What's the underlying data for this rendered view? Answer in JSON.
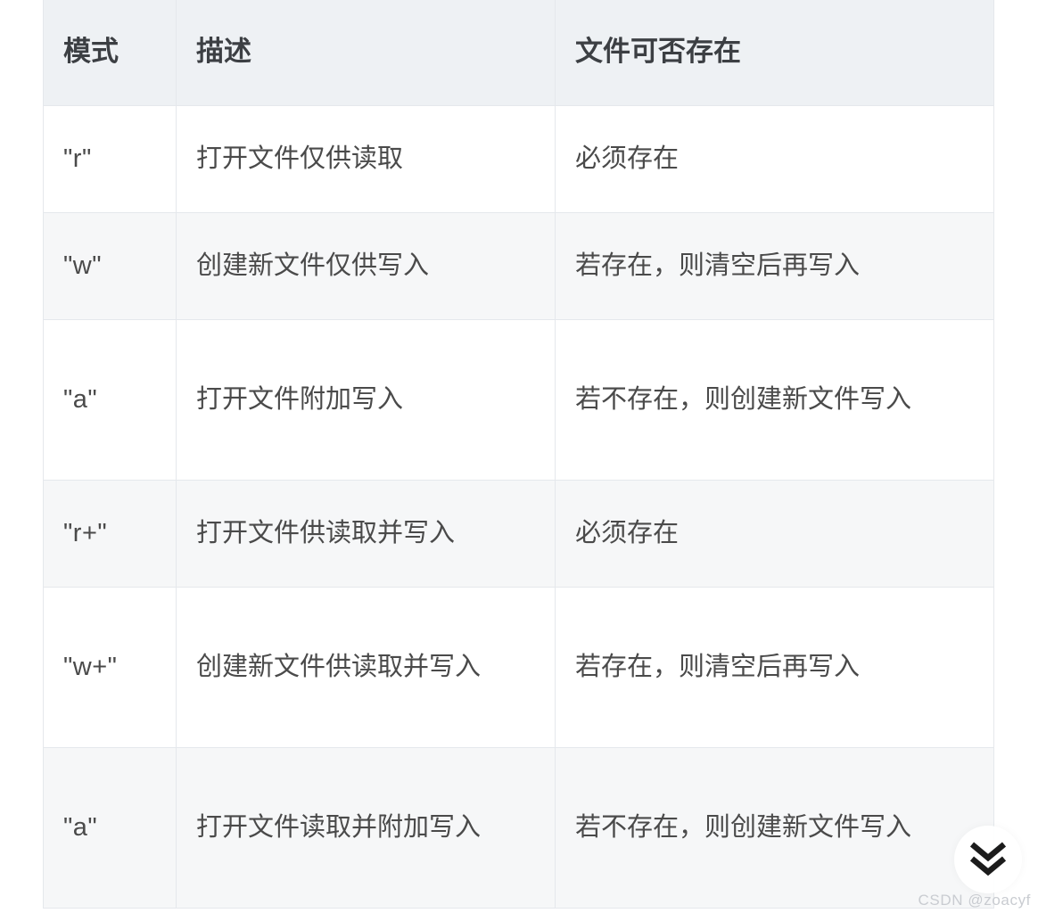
{
  "table": {
    "headers": [
      "模式",
      "描述",
      "文件可否存在"
    ],
    "rows": [
      {
        "mode": "\"r\"",
        "description": "打开文件仅供读取",
        "existence": "必须存在"
      },
      {
        "mode": "\"w\"",
        "description": "创建新文件仅供写入",
        "existence": "若存在，则清空后再写入"
      },
      {
        "mode": "\"a\"",
        "description": "打开文件附加写入",
        "existence": "若不存在，则创建新文件写入"
      },
      {
        "mode": "\"r+\"",
        "description": "打开文件供读取并写入",
        "existence": "必须存在"
      },
      {
        "mode": "\"w+\"",
        "description": "创建新文件供读取并写入",
        "existence": "若存在，则清空后再写入"
      },
      {
        "mode": "\"a\"",
        "description": "打开文件读取并附加写入",
        "existence": "若不存在，则创建新文件写入"
      }
    ]
  },
  "overlay": {
    "scroll_down_icon": "chevron-double-down-icon",
    "watermark": "CSDN @zoacyf"
  },
  "colors": {
    "header_bg": "#eef1f4",
    "row_alt_bg": "#f6f7f8",
    "border": "#e5e8ec",
    "header_text": "#3c3f43",
    "body_text": "#4a4a4a",
    "watermark_text": "#c9ccd1"
  }
}
